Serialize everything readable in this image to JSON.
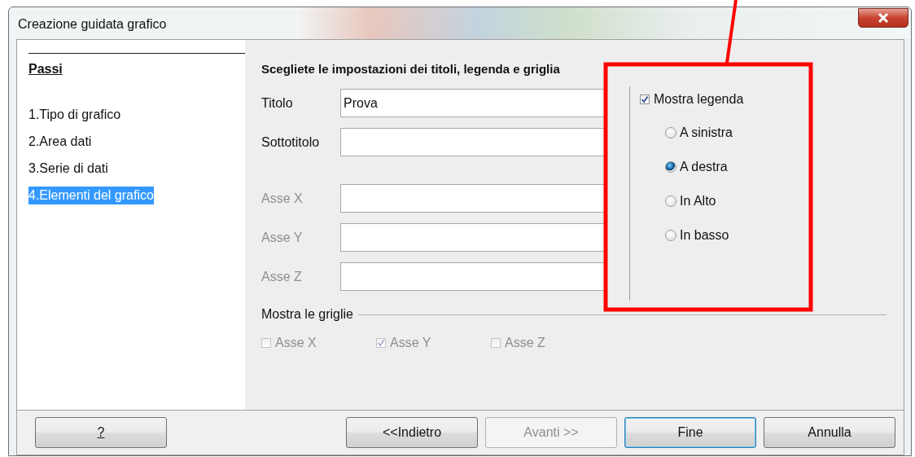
{
  "window": {
    "title": "Creazione guidata grafico"
  },
  "steps": {
    "heading": "Passi",
    "items": [
      {
        "label": "1.Tipo di grafico",
        "selected": false
      },
      {
        "label": "2.Area dati",
        "selected": false
      },
      {
        "label": "3.Serie di dati",
        "selected": false
      },
      {
        "label": "4.Elementi del grafico",
        "selected": true
      }
    ]
  },
  "heading": "Scegliete le impostazioni dei titoli, legenda e griglia",
  "fields": [
    {
      "label": "Titolo",
      "value": "Prova",
      "disabled": false
    },
    {
      "label": "Sottotitolo",
      "disabled": false
    },
    {
      "label": "Asse X",
      "disabled": true
    },
    {
      "label": "Asse Y",
      "disabled": true
    },
    {
      "label": "Asse Z",
      "disabled": true
    }
  ],
  "legend": {
    "label": "Mostra legenda",
    "checked": true,
    "options": [
      {
        "label": "A sinistra",
        "selected": false
      },
      {
        "label": "A destra",
        "selected": true
      },
      {
        "label": "In Alto",
        "selected": false
      },
      {
        "label": "In basso",
        "selected": false
      }
    ]
  },
  "grids": {
    "label": "Mostra le griglie",
    "items": [
      {
        "label": "Asse X",
        "checked": false,
        "disabled": true
      },
      {
        "label": "Asse Y",
        "checked": true,
        "disabled": true
      },
      {
        "label": "Asse Z",
        "checked": false,
        "disabled": true
      }
    ]
  },
  "buttons": {
    "help": {
      "label": "?",
      "disabled": false
    },
    "actions": [
      {
        "label": "<<Indietro",
        "disabled": false,
        "default": false
      },
      {
        "label": "Avanti >>",
        "disabled": true,
        "default": false
      },
      {
        "label": "Fine",
        "disabled": false,
        "default": true
      },
      {
        "label": "Annulla",
        "disabled": false,
        "default": false
      }
    ]
  }
}
